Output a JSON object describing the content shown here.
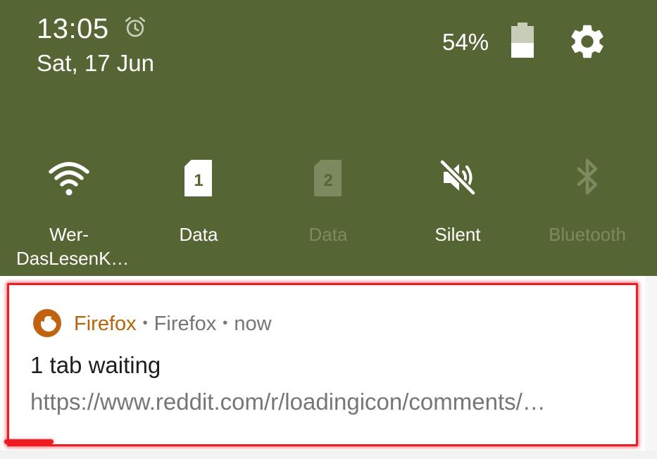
{
  "status": {
    "time": "13:05",
    "date": "Sat, 17 Jun",
    "battery_percent": "54%",
    "battery_level": 0.54,
    "alarm_icon": "alarm-clock-icon",
    "settings_icon": "gear-icon"
  },
  "tiles": [
    {
      "label": "Wer-\nDasLesenK…",
      "icon": "wifi-icon",
      "active": true
    },
    {
      "label": "Data",
      "icon": "sim-1-icon",
      "active": true
    },
    {
      "label": "Data",
      "icon": "sim-2-icon",
      "active": false
    },
    {
      "label": "Silent",
      "icon": "volume-off-icon",
      "active": true
    },
    {
      "label": "Bluetooth",
      "icon": "bluetooth-icon",
      "active": false
    }
  ],
  "notification": {
    "app_name": "Firefox",
    "sub_text": "Firefox",
    "when": "now",
    "separator": "•",
    "title": "1 tab waiting",
    "text": "https://www.reddit.com/r/loadingicon/comments/…",
    "icon": "firefox-icon"
  },
  "colors": {
    "shade_bg": "#566534",
    "app_accent": "#b8640a",
    "highlight": "#ec1c24"
  }
}
